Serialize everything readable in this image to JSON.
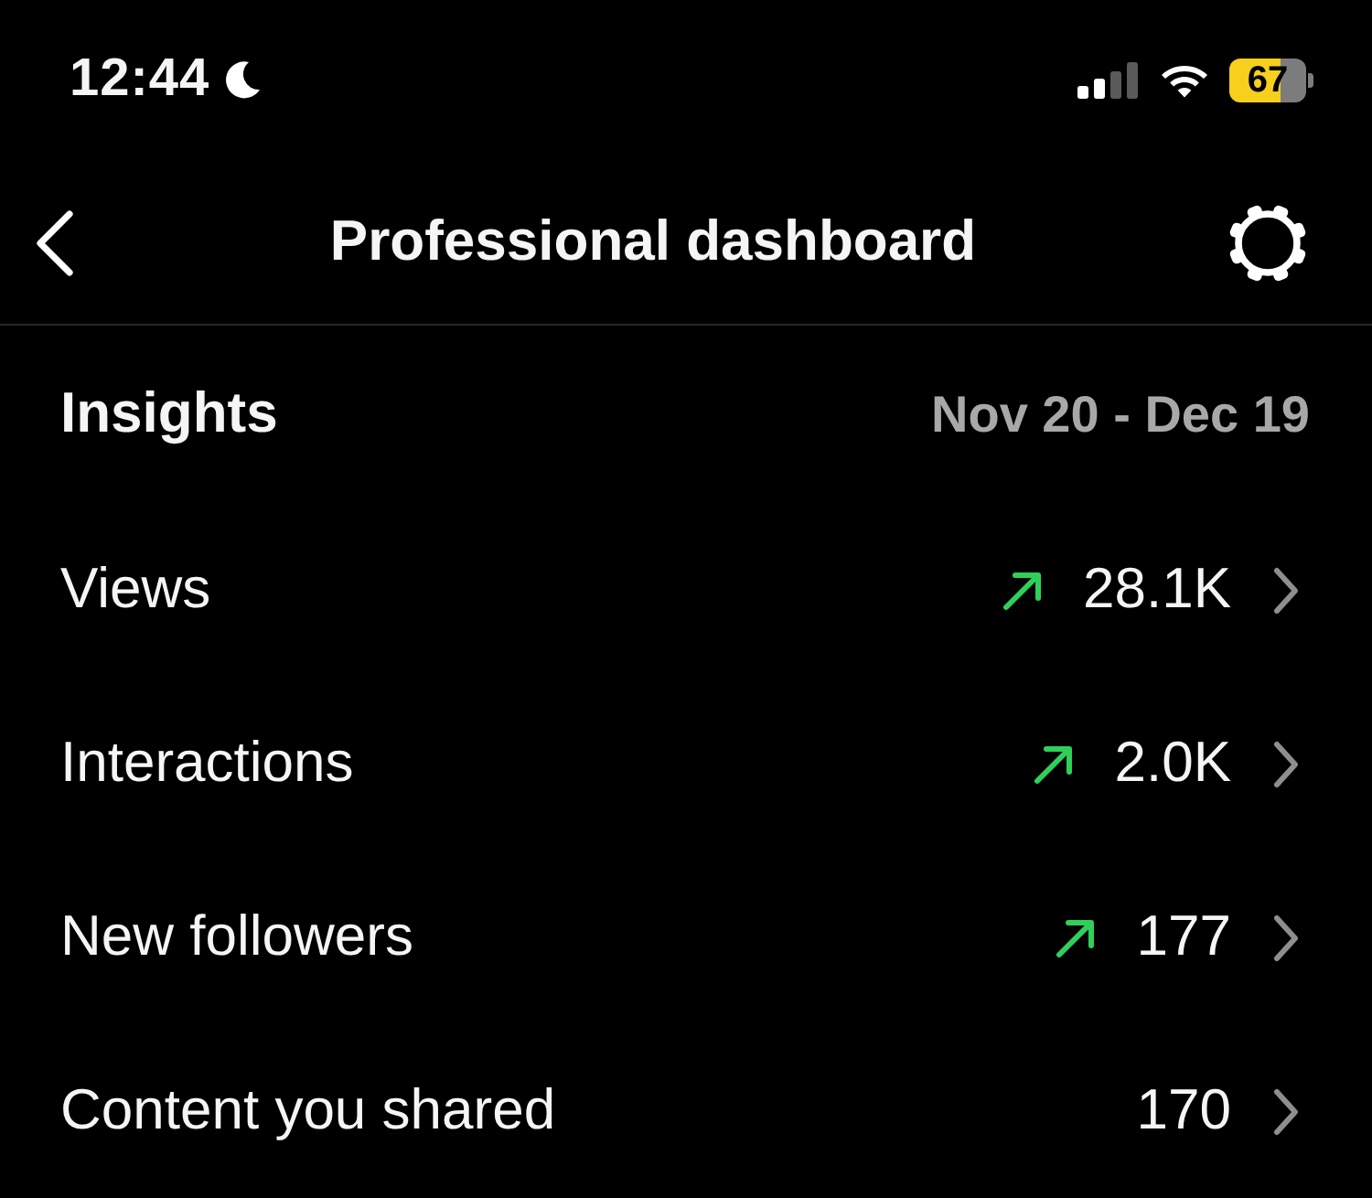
{
  "status_bar": {
    "time": "12:44",
    "battery": "67"
  },
  "header": {
    "title": "Professional dashboard"
  },
  "insights": {
    "title": "Insights",
    "date_range": "Nov 20 - Dec 19"
  },
  "metrics": [
    {
      "label": "Views",
      "value": "28.1K",
      "trending_up": true
    },
    {
      "label": "Interactions",
      "value": "2.0K",
      "trending_up": true
    },
    {
      "label": "New followers",
      "value": "177",
      "trending_up": true
    },
    {
      "label": "Content you shared",
      "value": "170",
      "trending_up": false
    }
  ]
}
